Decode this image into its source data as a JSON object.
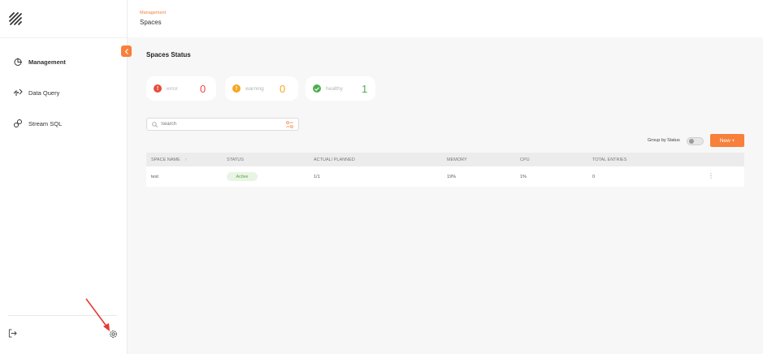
{
  "header": {
    "breadcrumb": "Management",
    "title": "Spaces"
  },
  "sidebar": {
    "items": [
      {
        "label": "Management",
        "icon": "management-icon"
      },
      {
        "label": "Data Query",
        "icon": "data-query-icon"
      },
      {
        "label": "Stream SQL",
        "icon": "stream-sql-icon"
      }
    ]
  },
  "status": {
    "title": "Spaces Status",
    "cards": [
      {
        "label": "error",
        "count": "0",
        "icon": "!"
      },
      {
        "label": "warning",
        "count": "0",
        "icon": "!"
      },
      {
        "label": "healthy",
        "count": "1",
        "icon": "check"
      }
    ]
  },
  "search": {
    "placeholder": "Search"
  },
  "toolbar": {
    "group_label": "Group by Status",
    "new_label": "New  +"
  },
  "table": {
    "columns": [
      "SPACE NAME",
      "STATUS",
      "ACTUAL/ PLANNED",
      "MEMORY",
      "CPU",
      "TOTAL ENTRIES"
    ],
    "sort_indicator": "↑",
    "rows": [
      {
        "name": "test",
        "status": "Active",
        "actual_planned": "1/1",
        "memory": "19%",
        "cpu": "1%",
        "entries": "0",
        "menu": "⋮"
      }
    ]
  },
  "colors": {
    "accent": "#f7803b",
    "error": "#e74c3c",
    "warning": "#f5a623",
    "healthy": "#4caf50"
  }
}
